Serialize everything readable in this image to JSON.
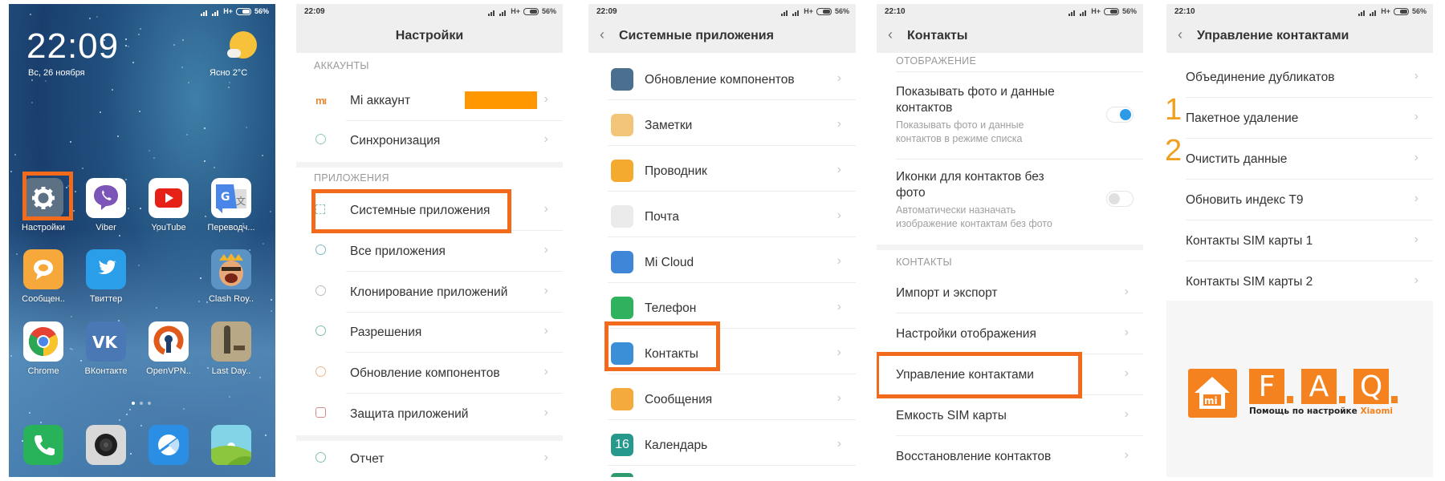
{
  "status_bar": {
    "battery": "56%",
    "network": "H+"
  },
  "home": {
    "clock": "22:09",
    "date": "Вс, 26 ноября",
    "weather": "Ясно  2°C",
    "apps": [
      {
        "name": "Настройки",
        "icon": "gear-icon"
      },
      {
        "name": "Viber",
        "icon": "viber-icon"
      },
      {
        "name": "YouTube",
        "icon": "youtube-icon"
      },
      {
        "name": "Переводч...",
        "icon": "translate-icon"
      },
      {
        "name": "Сообщен..",
        "icon": "messages-icon"
      },
      {
        "name": "Твиттер",
        "icon": "twitter-icon"
      },
      {
        "name": "Clash Roy..",
        "icon": "clash-royale-icon"
      },
      {
        "name": "Chrome",
        "icon": "chrome-icon"
      },
      {
        "name": "ВКонтакте",
        "icon": "vk-icon"
      },
      {
        "name": "OpenVPN..",
        "icon": "openvpn-icon"
      },
      {
        "name": "Last Day..",
        "icon": "last-day-icon"
      }
    ],
    "dock": [
      {
        "icon": "phone-icon"
      },
      {
        "icon": "camera-icon"
      },
      {
        "icon": "browser-icon"
      },
      {
        "icon": "gallery-icon"
      }
    ]
  },
  "settings": {
    "time": "22:09",
    "title": "Настройки",
    "section_accounts": "АККАУНТЫ",
    "section_apps": "ПРИЛОЖЕНИЯ",
    "items": [
      {
        "label": "Mi аккаунт",
        "icon": "mi-icon"
      },
      {
        "label": "Синхронизация",
        "icon": "sync-icon"
      },
      {
        "label": "Системные приложения",
        "icon": "grid-icon"
      },
      {
        "label": "Все приложения",
        "icon": "more-icon"
      },
      {
        "label": "Клонирование приложений",
        "icon": "clone-icon"
      },
      {
        "label": "Разрешения",
        "icon": "permission-icon"
      },
      {
        "label": "Обновление компонентов",
        "icon": "update-icon"
      },
      {
        "label": "Защита приложений",
        "icon": "shield-icon"
      },
      {
        "label": "Отчет",
        "icon": "help-icon"
      }
    ]
  },
  "system_apps": {
    "time": "22:09",
    "title": "Системные приложения",
    "items": [
      {
        "label": "Обновление компонентов",
        "color": "#4a6f8f"
      },
      {
        "label": "Заметки",
        "color": "#f3c57a"
      },
      {
        "label": "Проводник",
        "color": "#f4a92f"
      },
      {
        "label": "Почта",
        "color": "#ebebeb"
      },
      {
        "label": "Mi Cloud",
        "color": "#3f86d8"
      },
      {
        "label": "Телефон",
        "color": "#2fb25d"
      },
      {
        "label": "Контакты",
        "color": "#3a8fd6"
      },
      {
        "label": "Сообщения",
        "color": "#f4aa3d"
      },
      {
        "label": "Календарь",
        "color": "#26998c",
        "glyph": "16"
      }
    ]
  },
  "contacts": {
    "time": "22:10",
    "title": "Контакты",
    "section_display": "ОТОБРАЖЕНИЕ",
    "toggles": [
      {
        "title": "Показывать фото и данные контактов",
        "title_l1": "Показывать фото и данные",
        "title_l2": "контактов",
        "desc_l1": "Показывать фото и данные",
        "desc_l2": "контактов в режиме списка",
        "on": true
      },
      {
        "title": "Иконки для контактов без фото",
        "title_l1": "Иконки для контактов без",
        "title_l2": "фото",
        "desc_l1": "Автоматически назначать",
        "desc_l2": "изображение контактам без фото",
        "on": false
      }
    ],
    "section_contacts": "КОНТАКТЫ",
    "items": [
      {
        "label": "Импорт и экспорт"
      },
      {
        "label": "Настройки отображения"
      },
      {
        "label": "Управление контактами"
      },
      {
        "label": "Емкость SIM карты"
      },
      {
        "label": "Восстановление контактов"
      }
    ]
  },
  "manage_contacts": {
    "time": "22:10",
    "title": "Управление контактами",
    "items": [
      {
        "label": "Объединение дубликатов"
      },
      {
        "label": "Пакетное удаление",
        "step": "1"
      },
      {
        "label": "Очистить данные",
        "step": "2"
      },
      {
        "label": "Обновить индекс T9"
      },
      {
        "label": "Контакты SIM карты 1"
      },
      {
        "label": "Контакты SIM карты 2"
      }
    ]
  },
  "logo": {
    "letters": [
      "F",
      "A",
      "Q"
    ],
    "house_label": "mi",
    "tagline": "Помощь по настройке",
    "brand": "Xiaomi",
    "color": "#f4821f"
  },
  "highlight_color": "#f26b1d"
}
